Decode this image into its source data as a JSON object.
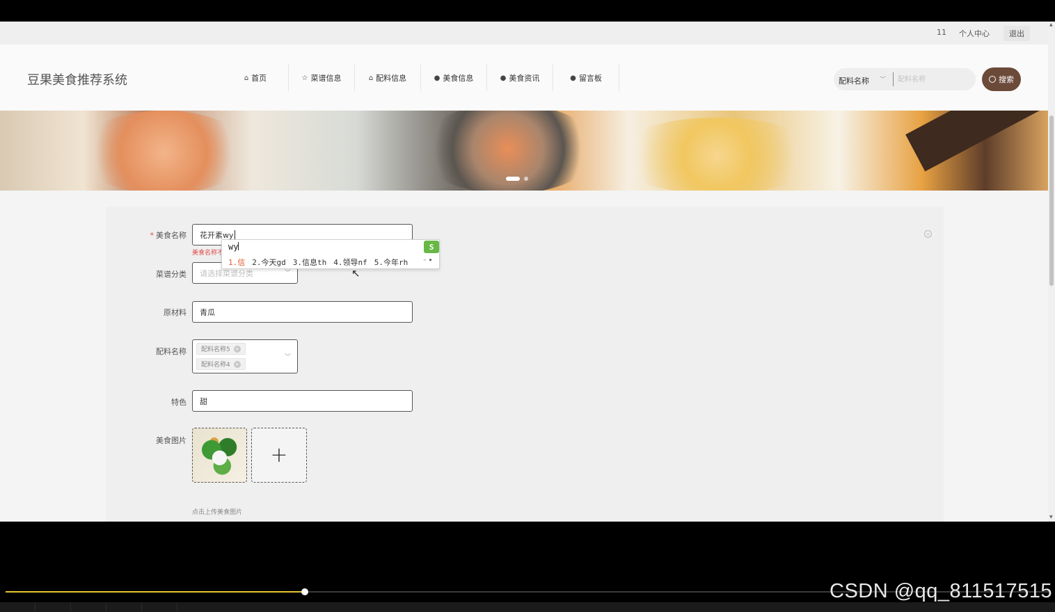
{
  "topbar": {
    "user": "11",
    "user_center": "个人中心",
    "logout": "退出"
  },
  "header": {
    "logo": "豆果美食推荐系统",
    "nav": [
      {
        "icon": "home-icon",
        "glyph": "⌂",
        "label": "首页"
      },
      {
        "icon": "star-icon",
        "glyph": "☆",
        "label": "菜谱信息"
      },
      {
        "icon": "bag-icon",
        "glyph": "⌂",
        "label": "配料信息"
      },
      {
        "icon": "info-icon",
        "glyph": "●",
        "label": "美食信息"
      },
      {
        "icon": "question-icon",
        "glyph": "●",
        "label": "美食资讯"
      },
      {
        "icon": "info-icon",
        "glyph": "●",
        "label": "留言板"
      }
    ],
    "search": {
      "select_value": "配料名称",
      "placeholder": "配料名称",
      "button_label": "搜索"
    }
  },
  "form": {
    "food_name": {
      "label": "美食名称",
      "value": "花开素wy",
      "error": "美食名称不"
    },
    "category": {
      "label": "菜谱分类",
      "placeholder": "请选择菜谱分类"
    },
    "raw_material": {
      "label": "原材料",
      "value": "青瓜"
    },
    "ingredients": {
      "label": "配料名称",
      "tags": [
        "配料名称5",
        "配料名称4"
      ]
    },
    "feature": {
      "label": "特色",
      "value": "甜"
    },
    "image": {
      "label": "美食图片",
      "add_symbol": "+",
      "hint": "点击上传美食图片"
    }
  },
  "ime": {
    "composition": "wy",
    "logo": "S",
    "candidates": [
      "1.信",
      "2.今天gd",
      "3.信息th",
      "4.领导nf",
      "5.今年rh"
    ],
    "prev": "◂",
    "next": "▸"
  },
  "player": {
    "progress": 0.287,
    "watermark": "CSDN @qq_811517515"
  }
}
